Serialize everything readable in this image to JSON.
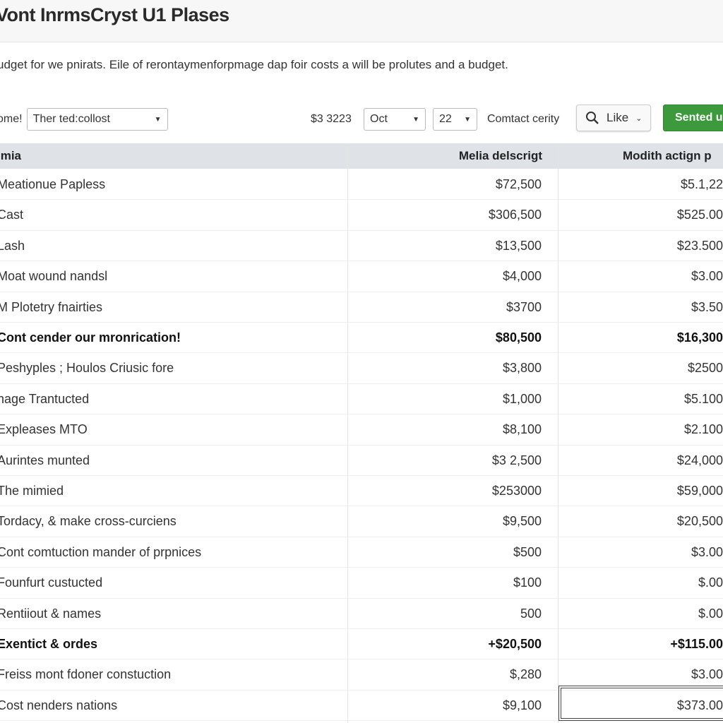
{
  "header": {
    "title": "Vont InrmsCryst U1 Plases"
  },
  "description": "udget for we pnirats. Eile of rerontaymenforpmage dap foir costs a will be prolutes and a budget.",
  "toolbar": {
    "label": "ome!",
    "filter_value": "Ther ted:collost",
    "amount": "$3 3223",
    "month_value": "Oct",
    "day_value": "22",
    "contact_label": "Comtact cerity",
    "like_label": "Like",
    "send_label": "Sented u",
    "send_color": "#3c9a3c"
  },
  "table": {
    "headers": [
      "Imia",
      "Melia delscrigt",
      "Modith actign p"
    ],
    "rows": [
      {
        "name": "Meationue Papless",
        "a": "$72,500",
        "b": "$5.1,22"
      },
      {
        "name": "Cast",
        "a": "$306,500",
        "b": "$525.00"
      },
      {
        "name": "Lash",
        "a": "$13,500",
        "b": "$23.500"
      },
      {
        "name": "Moat wound nandsl",
        "a": "$4,000",
        "b": "$3.00"
      },
      {
        "name": "M Plotetry fnairties",
        "a": "$3700",
        "b": "$3.50"
      },
      {
        "name": "Cont cender our mronrication!",
        "a": "$80,500",
        "b": "$16,300",
        "bold": true
      },
      {
        "name": "Peshyples ; Houlos Criusic fore",
        "a": "$3,800",
        "b": "$2500"
      },
      {
        "name": "nage Trantucted",
        "a": "$1,000",
        "b": "$5.100"
      },
      {
        "name": "Expleases MTO",
        "a": "$8,100",
        "b": "$2.100"
      },
      {
        "name": "Aurintes munted",
        "a": "$3 2,500",
        "b": "$24,000"
      },
      {
        "name": "The mimied",
        "a": "$253000",
        "b": "$59,000"
      },
      {
        "name": "Tordacy, & make cross-curciens",
        "a": "$9,500",
        "b": "$20,500"
      },
      {
        "name": "Cont comtuction mander of prpnices",
        "a": "$500",
        "b": "$3.00"
      },
      {
        "name": "Founfurt custucted",
        "a": "$100",
        "b": "$.00"
      },
      {
        "name": "Rentiiout & names",
        "a": "500",
        "b": "$.00"
      },
      {
        "name": "Exentict & ordes",
        "a": "+$20,500",
        "b": "+$115.00",
        "bold": true
      },
      {
        "name": "Freiss mont fdoner constuction",
        "a": "$,280",
        "b": "$3.00"
      },
      {
        "name": "Cost nenders nations",
        "a": "$9,100",
        "b": "$373.00"
      }
    ]
  }
}
